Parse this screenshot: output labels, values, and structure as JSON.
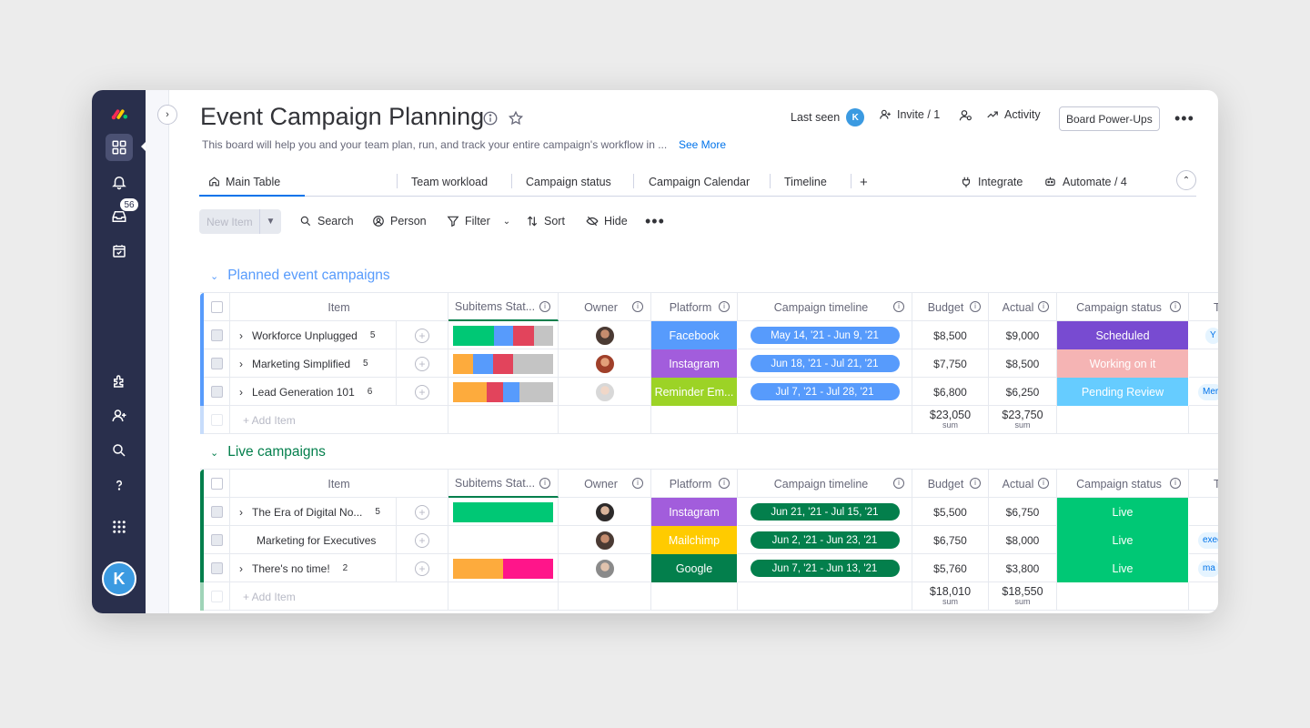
{
  "header": {
    "title": "Event Campaign Planning",
    "subtitle": "This board will help you and your team plan, run, and track your entire campaign's workflow in ...",
    "see_more": "See More",
    "last_seen": "Last seen",
    "last_seen_avatar": "K",
    "invite": "Invite / 1",
    "activity": "Activity",
    "power_ups": "Board Power-Ups"
  },
  "rail": {
    "inbox_badge": "56",
    "user_avatar": "K"
  },
  "tabs": {
    "main": "Main Table",
    "team_workload": "Team workload",
    "campaign_status": "Campaign status",
    "campaign_calendar": "Campaign Calendar",
    "timeline": "Timeline",
    "add": "+",
    "integrate": "Integrate",
    "automate": "Automate / 4"
  },
  "toolbar": {
    "new_item": "New Item",
    "search": "Search",
    "person": "Person",
    "filter": "Filter",
    "sort": "Sort",
    "hide": "Hide"
  },
  "columns": {
    "item": "Item",
    "subitems": "Subitems Stat...",
    "owner": "Owner",
    "platform": "Platform",
    "timeline": "Campaign timeline",
    "budget": "Budget",
    "actual": "Actual",
    "status": "Campaign status",
    "extra": "T"
  },
  "colors": {
    "planned_group": "#579bfc",
    "live_group": "#037f4c",
    "facebook": "#579bfc",
    "instagram": "#a25ddc",
    "reminder": "#9cd326",
    "mailchimp": "#ffcb00",
    "google": "#037f4c",
    "scheduled": "#784bd1",
    "working": "#f5b4b4",
    "pending": "#66ccff",
    "live": "#00c875"
  },
  "groups": [
    {
      "title": "Planned event campaigns",
      "rows": [
        {
          "name": "Workforce Unplugged",
          "count": "5",
          "platform": "Facebook",
          "timeline": "May 14, '21 - Jun 9, '21",
          "budget": "$8,500",
          "actual": "$9,000",
          "status": "Scheduled",
          "extra": "Y"
        },
        {
          "name": "Marketing Simplified",
          "count": "5",
          "platform": "Instagram",
          "timeline": "Jun 18, '21 - Jul 21, '21",
          "budget": "$7,750",
          "actual": "$8,500",
          "status": "Working on it",
          "extra": ""
        },
        {
          "name": "Lead Generation 101",
          "count": "6",
          "platform": "Reminder Em...",
          "timeline": "Jul 7, '21 - Jul 28, '21",
          "budget": "$6,800",
          "actual": "$6,250",
          "status": "Pending Review",
          "extra": "Mer"
        }
      ],
      "add_item": "+ Add Item",
      "budget_sum": "$23,050",
      "actual_sum": "$23,750",
      "sum_label": "sum"
    },
    {
      "title": "Live campaigns",
      "rows": [
        {
          "name": "The Era of Digital No...",
          "count": "5",
          "platform": "Instagram",
          "timeline": "Jun 21, '21 - Jul 15, '21",
          "budget": "$5,500",
          "actual": "$6,750",
          "status": "Live",
          "extra": ""
        },
        {
          "name": "Marketing for Executives",
          "count": "",
          "platform": "Mailchimp",
          "timeline": "Jun 2, '21 - Jun 23, '21",
          "budget": "$6,750",
          "actual": "$8,000",
          "status": "Live",
          "extra": "exec"
        },
        {
          "name": "There's no time!",
          "count": "2",
          "platform": "Google",
          "timeline": "Jun 7, '21 - Jun 13, '21",
          "budget": "$5,760",
          "actual": "$3,800",
          "status": "Live",
          "extra": "ma"
        }
      ],
      "add_item": "+ Add Item",
      "budget_sum": "$18,010",
      "actual_sum": "$18,550",
      "sum_label": "sum"
    }
  ]
}
